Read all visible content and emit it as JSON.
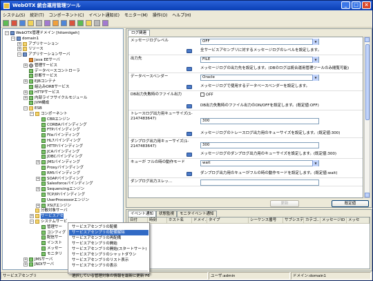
{
  "window": {
    "title": "WebOTX 統合運用管理ツール"
  },
  "menubar": [
    "システム(S)",
    "統計(T)",
    "コンポーネント(C)",
    "イベント通知(E)",
    "モニター(M)",
    "操作(O)",
    "ヘルプ(H)"
  ],
  "tree": [
    {
      "label": "WebOTX管理ドメイン [hitomiigeh]",
      "icon": "server-icon",
      "exp": "−",
      "indent": 0
    },
    {
      "label": "domain1",
      "icon": "server-icon",
      "exp": "−",
      "indent": 1
    },
    {
      "label": "アプリケーション",
      "icon": "folder-icon",
      "exp": "+",
      "indent": 2
    },
    {
      "label": "リソース",
      "icon": "folder-icon",
      "exp": "+",
      "indent": 2
    },
    {
      "label": "アプリケーションサーバ",
      "icon": "server-icon",
      "exp": "−",
      "indent": 2
    },
    {
      "label": "Java EEサーバ",
      "icon": "java-icon",
      "exp": "",
      "indent": 3
    },
    {
      "label": "管理サービス",
      "icon": "gear-icon",
      "exp": "+",
      "indent": 3
    },
    {
      "label": "データベースコントローラ",
      "icon": "comp-icon",
      "exp": "",
      "indent": 3
    },
    {
      "label": "診断サービス",
      "icon": "comp-icon",
      "exp": "",
      "indent": 3
    },
    {
      "label": "EJBコンテナ",
      "icon": "comp-icon",
      "exp": "+",
      "indent": 3
    },
    {
      "label": "組込みORBサービス",
      "icon": "comp-icon",
      "exp": "",
      "indent": 3
    },
    {
      "label": "HTTPサービス",
      "icon": "comp-icon",
      "exp": "+",
      "indent": 3
    },
    {
      "label": "内部ライフサイクルモジュール",
      "icon": "comp-icon",
      "exp": "+",
      "indent": 3
    },
    {
      "label": "JVM構成",
      "icon": "comp-icon",
      "exp": "",
      "indent": 3
    },
    {
      "label": "ESB",
      "icon": "folder-icon",
      "exp": "−",
      "indent": 3
    },
    {
      "label": "コンポーネント",
      "icon": "folder-icon",
      "exp": "−",
      "indent": 4
    },
    {
      "label": "CBRエンジン",
      "icon": "comp-icon",
      "exp": "",
      "indent": 5
    },
    {
      "label": "CORBAバインディング",
      "icon": "comp-icon",
      "exp": "",
      "indent": 5
    },
    {
      "label": "FTPバインディング",
      "icon": "comp-icon",
      "exp": "",
      "indent": 5
    },
    {
      "label": "Fileバインディング",
      "icon": "comp-icon",
      "exp": "",
      "indent": 5
    },
    {
      "label": "HL7バインディング",
      "icon": "comp-icon",
      "exp": "",
      "indent": 5
    },
    {
      "label": "HTTPバインディング",
      "icon": "comp-icon",
      "exp": "",
      "indent": 5
    },
    {
      "label": "JCAバインディング",
      "icon": "comp-icon",
      "exp": "",
      "indent": 5
    },
    {
      "label": "JDBCバインディング",
      "icon": "comp-icon",
      "exp": "",
      "indent": 5
    },
    {
      "label": "JMSバインディング",
      "icon": "comp-icon",
      "exp": "+",
      "indent": 5
    },
    {
      "label": "Proxyバインディング",
      "icon": "comp-icon",
      "exp": "",
      "indent": 5
    },
    {
      "label": "RMIバインディング",
      "icon": "comp-icon",
      "exp": "",
      "indent": 5
    },
    {
      "label": "SOAPバインディング",
      "icon": "comp-icon",
      "exp": "+",
      "indent": 5
    },
    {
      "label": "Salesforceバインディング",
      "icon": "comp-icon",
      "exp": "",
      "indent": 5
    },
    {
      "label": "Sequencingエンジン",
      "icon": "comp-icon",
      "exp": "+",
      "indent": 5
    },
    {
      "label": "TCP/IPバインディング",
      "icon": "comp-icon",
      "exp": "",
      "indent": 5
    },
    {
      "label": "UserProcessorエンジン",
      "icon": "comp-icon",
      "exp": "",
      "indent": 5
    },
    {
      "label": "XSLTエンジン",
      "icon": "comp-icon",
      "exp": "+",
      "indent": 5
    },
    {
      "label": "分散対象サーバ",
      "icon": "folder-icon",
      "exp": "",
      "indent": 4
    },
    {
      "label": "サービスアセ",
      "icon": "folder-icon",
      "exp": "+",
      "indent": 4
    },
    {
      "label": "システムサービ",
      "icon": "folder-icon",
      "exp": "−",
      "indent": 4
    },
    {
      "label": "管理サー",
      "icon": "comp-icon",
      "exp": "",
      "indent": 5
    },
    {
      "label": "コンフィグ",
      "icon": "comp-icon",
      "exp": "",
      "indent": 5
    },
    {
      "label": "配信サー",
      "icon": "comp-icon",
      "exp": "",
      "indent": 5
    },
    {
      "label": "インスト",
      "icon": "comp-icon",
      "exp": "",
      "indent": 5
    },
    {
      "label": "メッセー",
      "icon": "comp-icon",
      "exp": "",
      "indent": 5
    },
    {
      "label": "モニタリ",
      "icon": "comp-icon",
      "exp": "",
      "indent": 5
    },
    {
      "label": "JMSサーバ",
      "icon": "comp-icon",
      "exp": "+",
      "indent": 3
    },
    {
      "label": "JNDIサーバ",
      "icon": "comp-icon",
      "exp": "+",
      "indent": 3
    }
  ],
  "right_tab": "ログ関連",
  "properties": [
    {
      "label": "メッセージログレベル",
      "value": "OFF",
      "type": "select",
      "desc": "全サービスアセンブリに対するメッセージログのレベルを設定します。"
    },
    {
      "label": "出力先",
      "value": "FILE",
      "type": "select",
      "desc": "メッセージログの出力先を設定します。(DBのログは統合運用管理ツールのみ閲覧可能)"
    },
    {
      "label": "データベースベンダー",
      "value": "Oracle",
      "type": "select",
      "desc": "メッセージログで使用するデータベースベンダーを設定します。"
    },
    {
      "label": "DB出力失敗時のファイル出力",
      "value": "OFF",
      "type": "check",
      "desc": "DB出力失敗時のファイル出力のON/OFFを設定します。(既定値:OFF)"
    },
    {
      "label": "トレースログ出力用キューサイズ(1-2147483647)",
      "value": "300",
      "type": "text",
      "desc": "メッセージログのトレースログ出力用のキューサイズを設定します。(既定値:300)"
    },
    {
      "label": "ダンプログ出力用キューサイズ(1-2147483647)",
      "value": "300",
      "type": "text",
      "desc": "メッセージログのダンプログ出力用のキューサイズを設定します。(既定値:300)"
    },
    {
      "label": "キューが フルの時の動作モード",
      "value": "wait",
      "type": "select",
      "desc": "ダンプログ出力用のキューがフルの時の動作モードを設定します。(既定値:wait)"
    },
    {
      "label": "ダンプログ出力スレッ...",
      "value": "",
      "type": "text",
      "desc": ""
    }
  ],
  "buttons": {
    "update": "更新",
    "default": "既定値"
  },
  "bottom_tabs": [
    "イベント通知",
    "状態監視",
    "モニタイベント通知"
  ],
  "event_columns": [
    "日付",
    "時刻",
    "ホスト名",
    "ドメイ..",
    "タイプ",
    "シーケンス番号",
    "サブシステ..",
    "カテゴ..",
    "メッセージID",
    "メッセ"
  ],
  "context_menu": [
    "サービスアセンブリの配備",
    "サービスアセンブリの配備解除",
    "サービスアセンブリの再配備",
    "サービスアセンブリの開始",
    "サービスアセンブリの開始(スタートサート)",
    "サービスアセンブリのシャットダウン",
    "サービスアセンブリのリスト表示",
    "サービスアセンブリの表示",
    "",
    "選択している管理対象の情報を最新に更新  F6"
  ],
  "status": {
    "left": "サービスアセンブリ",
    "user": "ユーザ:admin",
    "domain": "ドメイン:domain1"
  }
}
